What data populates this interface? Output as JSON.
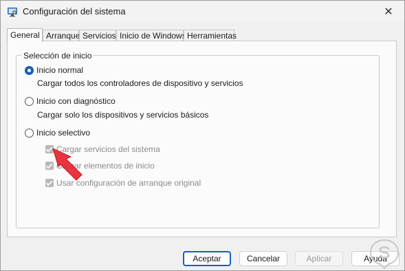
{
  "window": {
    "title": "Configuración del sistema",
    "close_glyph": "✕",
    "icon": "msconfig-icon"
  },
  "tabs": [
    {
      "label": "General",
      "active": true
    },
    {
      "label": "Arranque",
      "active": false
    },
    {
      "label": "Servicios",
      "active": false
    },
    {
      "label": "Inicio de Windows",
      "active": false
    },
    {
      "label": "Herramientas",
      "active": false
    }
  ],
  "startup_group": {
    "legend": "Selección de inicio",
    "options": [
      {
        "label": "Inicio normal",
        "description": "Cargar todos los controladores de dispositivo y servicios",
        "checked": true
      },
      {
        "label": "Inicio con diagnóstico",
        "description": "Cargar solo los dispositivos y servicios básicos",
        "checked": false
      },
      {
        "label": "Inicio selectivo",
        "checked": false
      }
    ],
    "selective_items": [
      {
        "label": "Cargar servicios del sistema",
        "checked": true,
        "enabled": false
      },
      {
        "label": "Cargar elementos de inicio",
        "checked": true,
        "enabled": false
      },
      {
        "label": "Usar configuración de arranque original",
        "checked": true,
        "enabled": false
      }
    ]
  },
  "buttons": {
    "ok": "Aceptar",
    "cancel": "Cancelar",
    "apply": "Aplicar",
    "help": "Ayuda"
  },
  "colors": {
    "accent": "#1a5fb4",
    "arrow": "#e8353f",
    "disabled_text": "#8a8a8a"
  }
}
